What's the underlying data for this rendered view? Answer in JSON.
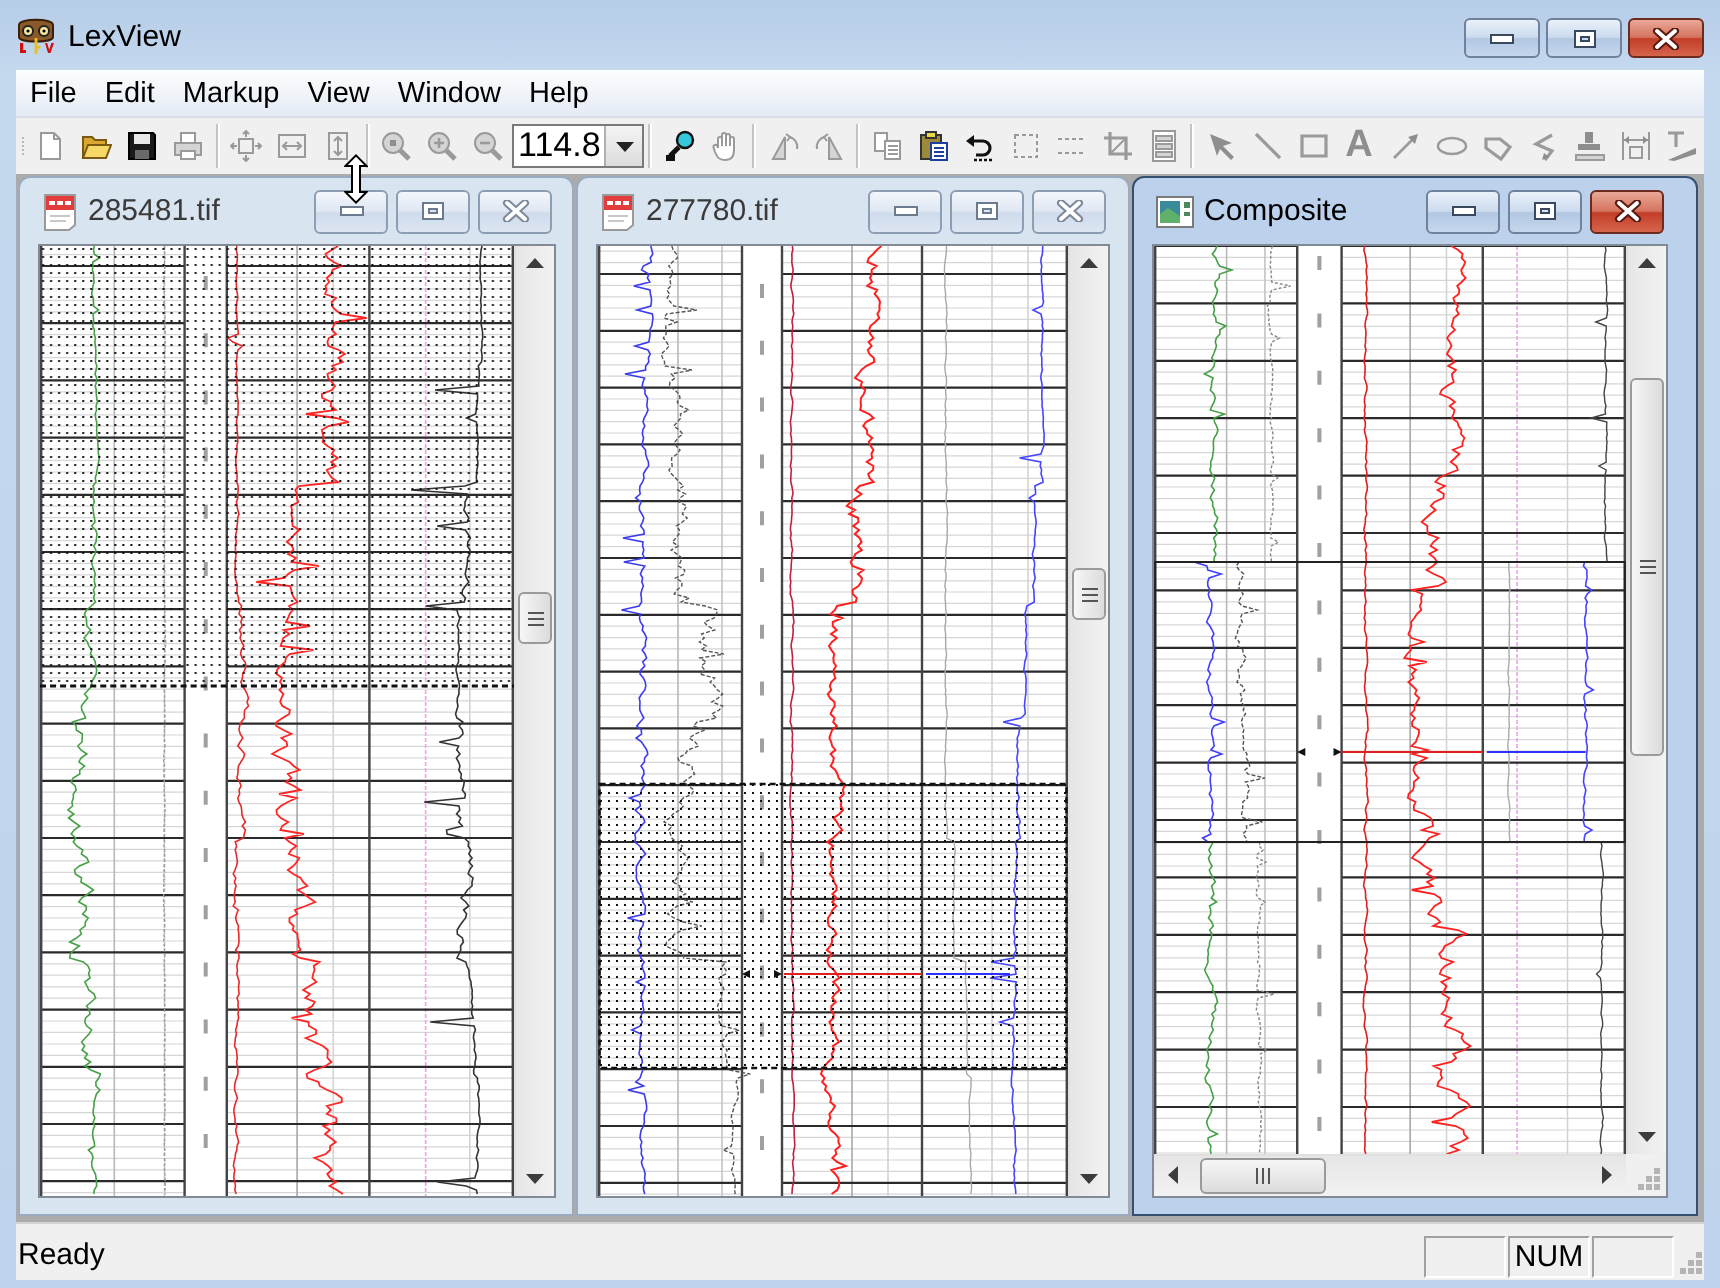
{
  "window": {
    "title": "LexView"
  },
  "menu": [
    {
      "label": "File"
    },
    {
      "label": "Edit"
    },
    {
      "label": "Markup"
    },
    {
      "label": "View"
    },
    {
      "label": "Window"
    },
    {
      "label": "Help"
    }
  ],
  "toolbar": {
    "groups": [
      {
        "items": [
          {
            "kind": "icon",
            "disabled": true
          },
          {
            "kind": "icon",
            "disabled": false
          },
          {
            "kind": "icon",
            "disabled": false
          },
          {
            "kind": "icon",
            "disabled": true
          }
        ]
      },
      {
        "items": [
          {
            "kind": "icon",
            "disabled": true
          },
          {
            "kind": "icon",
            "disabled": true
          },
          {
            "kind": "icon",
            "disabled": true
          }
        ]
      },
      {
        "items": [
          {
            "kind": "icon",
            "disabled": true
          },
          {
            "kind": "icon",
            "disabled": true
          },
          {
            "kind": "icon",
            "disabled": true
          },
          {
            "kind": "combo",
            "value": "114.8"
          }
        ]
      },
      {
        "items": [
          {
            "kind": "icon",
            "disabled": false
          },
          {
            "kind": "icon",
            "disabled": true
          }
        ]
      },
      {
        "items": [
          {
            "kind": "icon",
            "disabled": true
          },
          {
            "kind": "icon",
            "disabled": true
          }
        ]
      },
      {
        "items": [
          {
            "kind": "icon",
            "disabled": true
          },
          {
            "kind": "icon",
            "disabled": false
          },
          {
            "kind": "icon",
            "disabled": false
          },
          {
            "kind": "icon",
            "disabled": true
          },
          {
            "kind": "icon",
            "disabled": true
          },
          {
            "kind": "icon",
            "disabled": true
          },
          {
            "kind": "icon",
            "disabled": true
          }
        ]
      },
      {
        "items": [
          {
            "kind": "icon",
            "disabled": true
          },
          {
            "kind": "icon",
            "disabled": true
          },
          {
            "kind": "icon",
            "disabled": true
          },
          {
            "kind": "glyph",
            "text": "A",
            "disabled": true
          },
          {
            "kind": "icon",
            "disabled": true
          },
          {
            "kind": "icon",
            "disabled": true
          },
          {
            "kind": "icon",
            "disabled": true
          },
          {
            "kind": "icon",
            "disabled": true
          },
          {
            "kind": "icon",
            "disabled": true
          },
          {
            "kind": "icon",
            "disabled": true
          },
          {
            "kind": "icon",
            "disabled": true
          }
        ]
      }
    ]
  },
  "windows": [
    {
      "title": "285481.tif",
      "kind": "document",
      "active": false
    },
    {
      "title": "277780.tif",
      "kind": "document",
      "active": false
    },
    {
      "title": "Composite",
      "kind": "composite",
      "active": true
    }
  ],
  "status_bar": {
    "text": "Ready",
    "panes": [
      {
        "kind": "empty"
      },
      {
        "kind": "text",
        "text": "NUM"
      },
      {
        "kind": "empty"
      }
    ]
  }
}
